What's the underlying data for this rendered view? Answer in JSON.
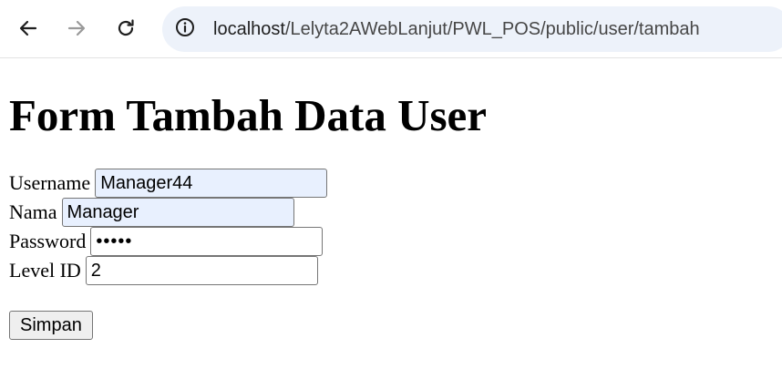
{
  "browser": {
    "url_host": "localhost",
    "url_path": "/Lelyta2AWebLanjut/PWL_POS/public/user/tambah"
  },
  "form": {
    "heading": "Form Tambah Data User",
    "username": {
      "label": "Username",
      "value": "Manager44"
    },
    "nama": {
      "label": "Nama",
      "value": "Manager"
    },
    "password": {
      "label": "Password",
      "value": "12345"
    },
    "level_id": {
      "label": "Level ID",
      "value": "2"
    },
    "submit_label": "Simpan"
  },
  "colors": {
    "autofill_bg": "#e8f0fe",
    "omnibox_bg": "#edf2fa"
  }
}
